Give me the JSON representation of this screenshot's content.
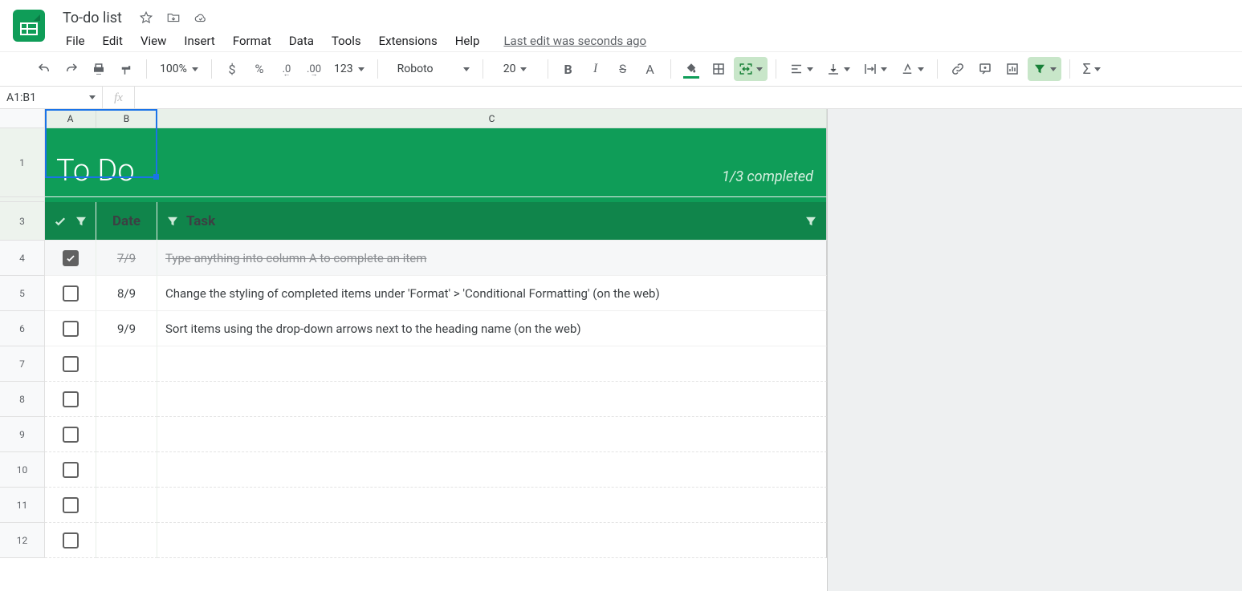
{
  "doc": {
    "title": "To-do list",
    "last_edit": "Last edit was seconds ago"
  },
  "menus": {
    "file": "File",
    "edit": "Edit",
    "view": "View",
    "insert": "Insert",
    "format": "Format",
    "data": "Data",
    "tools": "Tools",
    "extensions": "Extensions",
    "help": "Help"
  },
  "toolbar": {
    "zoom": "100%",
    "fmt123": "123",
    "font": "Roboto",
    "font_size": "20"
  },
  "namebox": "A1:B1",
  "columns": {
    "A": "A",
    "B": "B",
    "C": "C"
  },
  "rows": [
    "1",
    "",
    "3",
    "4",
    "5",
    "6",
    "7",
    "8",
    "9",
    "10",
    "11",
    "12"
  ],
  "todo": {
    "title": "To Do",
    "completed": "1/3 completed",
    "headers": {
      "date": "Date",
      "task": "Task"
    },
    "items": [
      {
        "checked": true,
        "date": "7/9",
        "task": "Type anything into column A to complete an item"
      },
      {
        "checked": false,
        "date": "8/9",
        "task": "Change the styling of completed items under 'Format' > 'Conditional Formatting' (on the web)"
      },
      {
        "checked": false,
        "date": "9/9",
        "task": "Sort items using the drop-down arrows next to the heading name (on the web)"
      },
      {
        "checked": false,
        "date": "",
        "task": ""
      },
      {
        "checked": false,
        "date": "",
        "task": ""
      },
      {
        "checked": false,
        "date": "",
        "task": ""
      },
      {
        "checked": false,
        "date": "",
        "task": ""
      },
      {
        "checked": false,
        "date": "",
        "task": ""
      },
      {
        "checked": false,
        "date": "",
        "task": ""
      }
    ]
  }
}
